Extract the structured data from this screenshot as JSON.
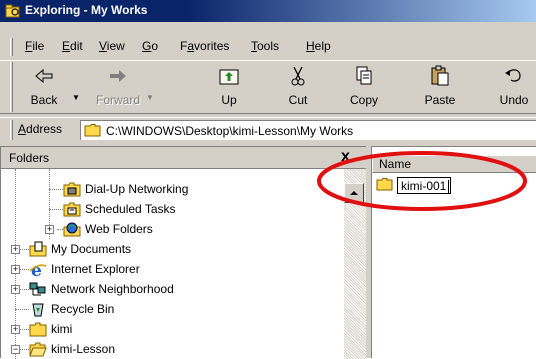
{
  "window": {
    "title": "Exploring - My Works"
  },
  "menu": [
    {
      "label": "File",
      "accel": "F",
      "rest": "ile"
    },
    {
      "label": "Edit",
      "accel": "E",
      "rest": "dit"
    },
    {
      "label": "View",
      "accel": "V",
      "rest": "iew"
    },
    {
      "label": "Go",
      "accel": "G",
      "rest": "o"
    },
    {
      "label": "Favorites",
      "accel": "a",
      "pre": "F",
      "rest": "vorites"
    },
    {
      "label": "Tools",
      "accel": "T",
      "rest": "ools"
    },
    {
      "label": "Help",
      "accel": "H",
      "rest": "elp"
    }
  ],
  "toolbar": {
    "back": "Back",
    "forward": "Forward",
    "up": "Up",
    "cut": "Cut",
    "copy": "Copy",
    "paste": "Paste",
    "undo": "Undo"
  },
  "address": {
    "label": "Address",
    "value": "C:\\WINDOWS\\Desktop\\kimi-Lesson\\My Works"
  },
  "folders": {
    "title": "Folders",
    "close": "x",
    "items": [
      {
        "label": "Dial-Up Networking",
        "icon": "dialup-networking-icon"
      },
      {
        "label": "Scheduled Tasks",
        "icon": "scheduled-tasks-icon"
      },
      {
        "label": "Web Folders",
        "icon": "web-folders-icon"
      },
      {
        "label": "My Documents",
        "icon": "my-documents-icon"
      },
      {
        "label": "Internet Explorer",
        "icon": "internet-explorer-icon"
      },
      {
        "label": "Network Neighborhood",
        "icon": "network-neighborhood-icon"
      },
      {
        "label": "Recycle Bin",
        "icon": "recycle-bin-icon"
      },
      {
        "label": "kimi",
        "icon": "folder-icon"
      },
      {
        "label": "kimi-Lesson",
        "icon": "folder-open-icon"
      }
    ]
  },
  "content": {
    "column_name": "Name",
    "rename_value": "kimi-001"
  },
  "colors": {
    "title_bar": "#0a246a",
    "face": "#d4d0c8",
    "folder": "#ffd94a",
    "annotation": "#e01010"
  }
}
